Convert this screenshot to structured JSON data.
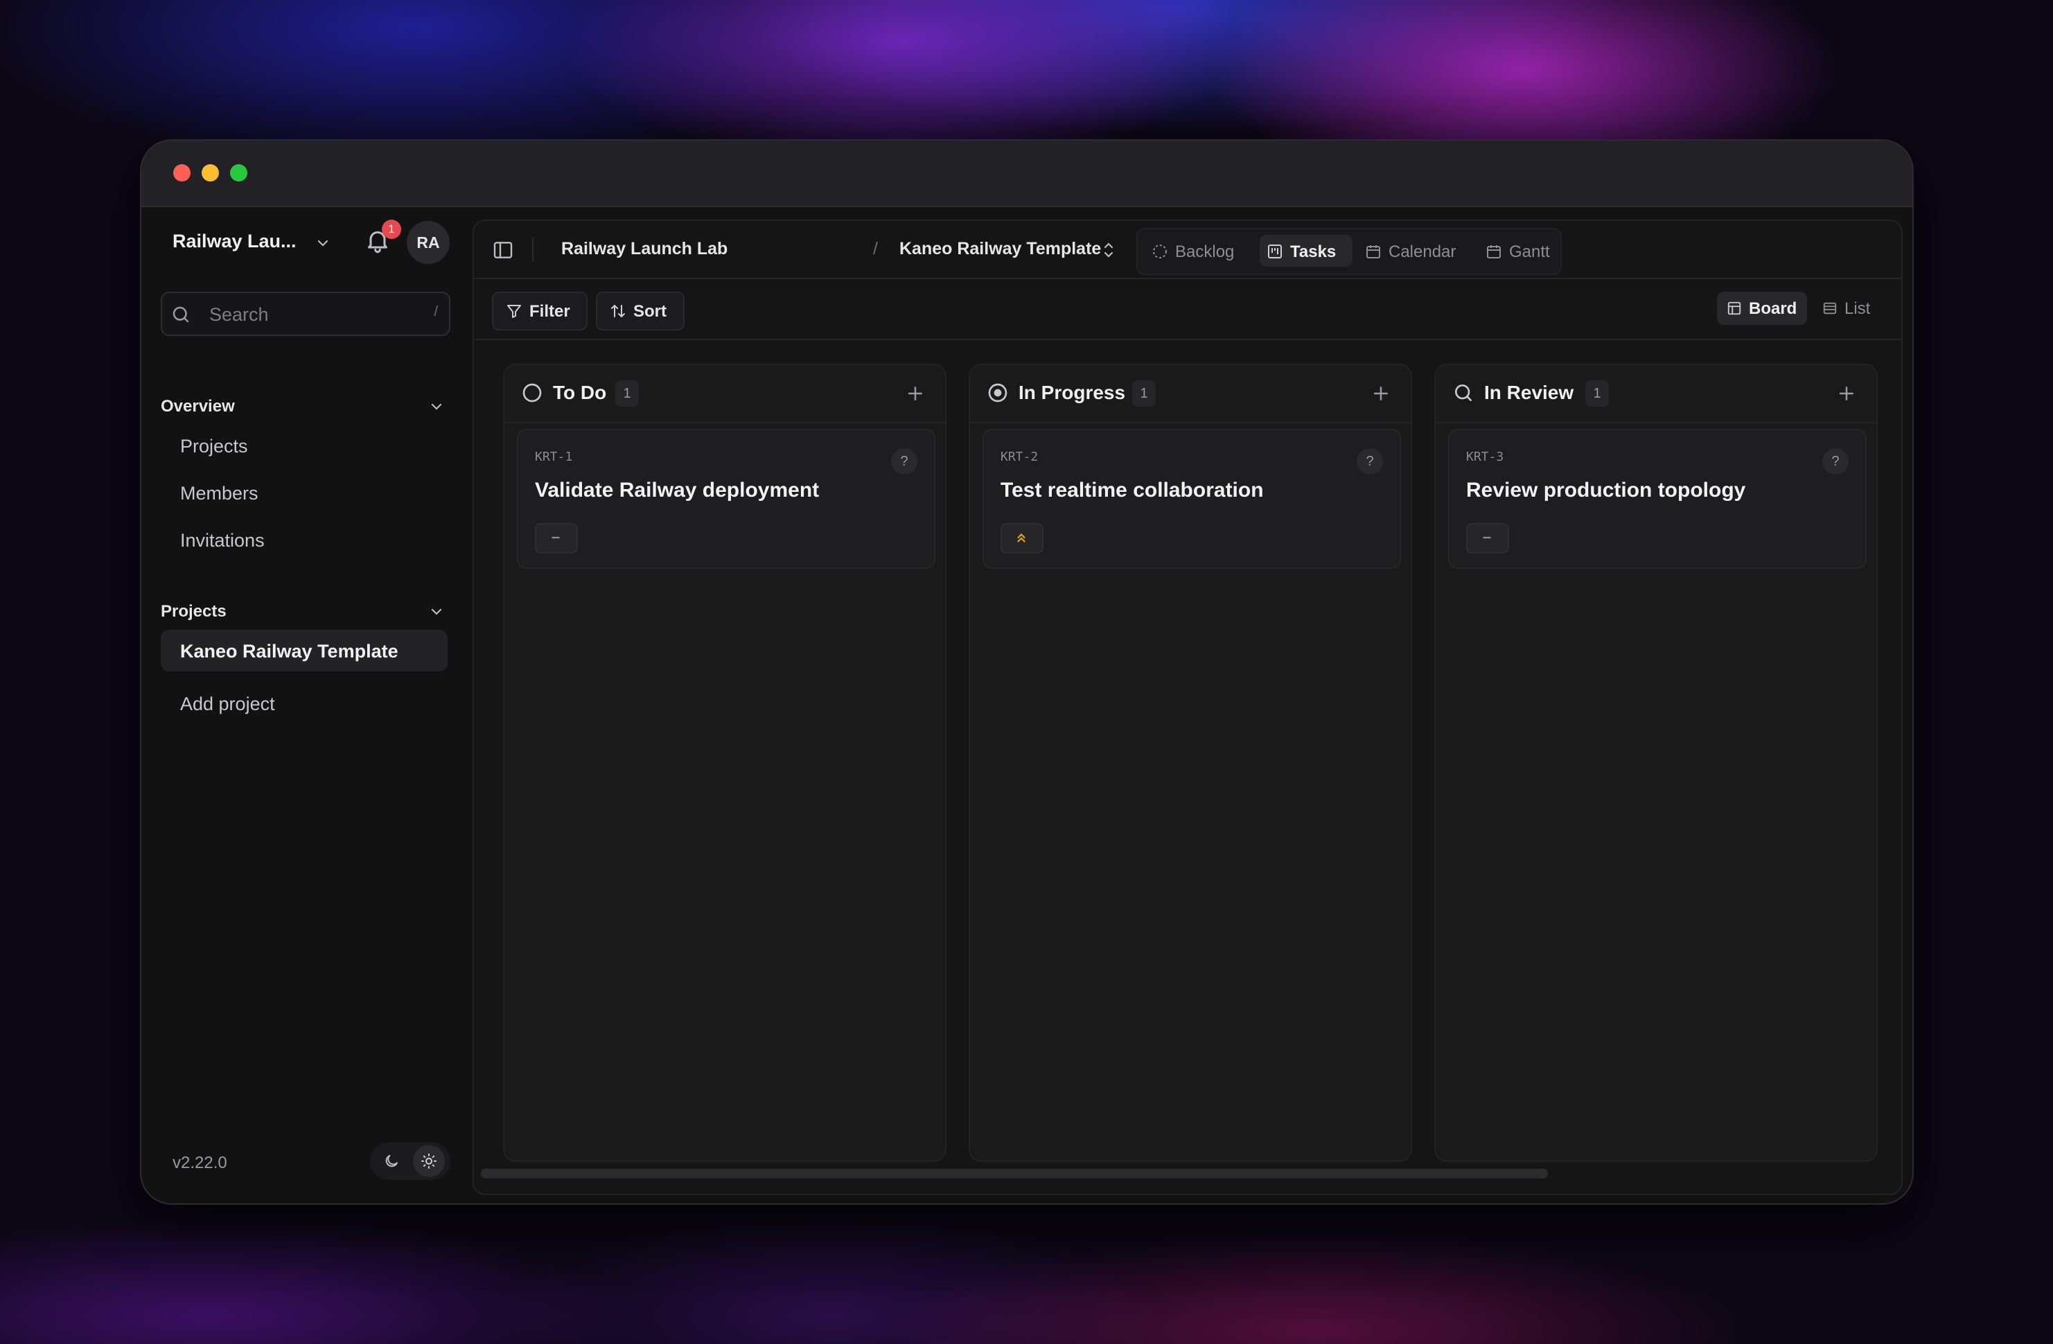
{
  "workspace": {
    "name": "Railway Lau...",
    "notification_count": "1",
    "avatar_initials": "RA"
  },
  "search": {
    "placeholder": "Search",
    "shortcut": "/"
  },
  "sidebar": {
    "overview_label": "Overview",
    "overview_items": [
      {
        "label": "Projects"
      },
      {
        "label": "Members"
      },
      {
        "label": "Invitations"
      }
    ],
    "projects_label": "Projects",
    "project_items": [
      {
        "label": "Kaneo Railway Template",
        "active": true
      }
    ],
    "add_project_label": "Add project",
    "version": "v2.22.0"
  },
  "header": {
    "breadcrumb": [
      "Railway Launch Lab",
      "Kaneo Railway Template"
    ],
    "separator": "/",
    "view_tabs": [
      {
        "label": "Backlog",
        "icon": "dashed-circle-icon"
      },
      {
        "label": "Tasks",
        "icon": "kanban-icon",
        "active": true
      },
      {
        "label": "Calendar",
        "icon": "calendar-icon"
      },
      {
        "label": "Gantt",
        "icon": "gantt-icon"
      }
    ]
  },
  "toolbar": {
    "filter_label": "Filter",
    "sort_label": "Sort",
    "board_label": "Board",
    "list_label": "List"
  },
  "board": {
    "columns": [
      {
        "title": "To Do",
        "count": "1",
        "icon": "empty-circle-icon",
        "cards": [
          {
            "key": "KRT-1",
            "title": "Validate Railway deployment",
            "help": "?",
            "priority": "no-priority"
          }
        ]
      },
      {
        "title": "In Progress",
        "count": "1",
        "icon": "progress-circle-icon",
        "cards": [
          {
            "key": "KRT-2",
            "title": "Test realtime collaboration",
            "help": "?",
            "priority": "high"
          }
        ]
      },
      {
        "title": "In Review",
        "count": "1",
        "icon": "magnifier-icon",
        "cards": [
          {
            "key": "KRT-3",
            "title": "Review production topology",
            "help": "?",
            "priority": "no-priority"
          }
        ]
      }
    ]
  },
  "colors": {
    "accent_priority_high": "#e0a020",
    "badge": "#e5484d"
  }
}
